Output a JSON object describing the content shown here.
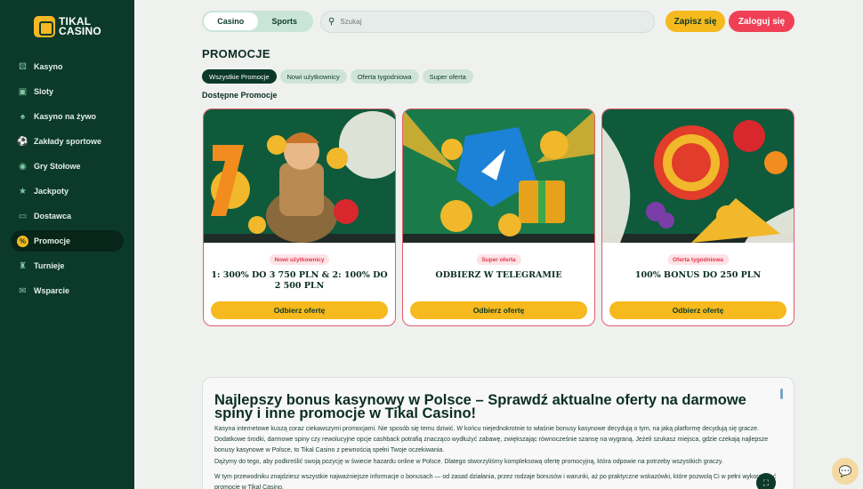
{
  "brand": {
    "line1": "TIKAL",
    "line2": "CASINO"
  },
  "sidebar": {
    "items": [
      {
        "label": "Kasyno",
        "icon": "dice-icon"
      },
      {
        "label": "Sloty",
        "icon": "slot-icon"
      },
      {
        "label": "Kasyno na żywo",
        "icon": "spade-icon"
      },
      {
        "label": "Zakłady sportowe",
        "icon": "football-icon"
      },
      {
        "label": "Gry Stołowe",
        "icon": "chips-icon"
      },
      {
        "label": "Jackpoty",
        "icon": "star-icon"
      },
      {
        "label": "Dostawca",
        "icon": "gamepad-icon"
      },
      {
        "label": "Promocje",
        "icon": "percent-icon",
        "active": true
      },
      {
        "label": "Turnieje",
        "icon": "trophy-icon"
      },
      {
        "label": "Wsparcie",
        "icon": "chat-icon"
      }
    ]
  },
  "header": {
    "tabs": [
      "Casino",
      "Sports"
    ],
    "search_placeholder": "Szukaj",
    "register_label": "Zapisz się",
    "login_label": "Zaloguj się"
  },
  "main": {
    "title": "PROMOCJE",
    "filters": [
      "Wszystkie Promocje",
      "Nowi użytkownicy",
      "Oferta tygodniowa",
      "Super oferta"
    ],
    "section_label": "Dostępne Promocje",
    "cards": [
      {
        "badge": "Nowi użytkownicy",
        "title": "1: 300% DO 3 750 PLN & 2: 100% DO 2 500 PLN",
        "button": "Odbierz ofertę"
      },
      {
        "badge": "Super oferta",
        "title": "ODBIERZ W TELEGRAMIE",
        "button": "Odbierz ofertę"
      },
      {
        "badge": "Oferta tygodniowa",
        "title": "100% BONUS DO 250 PLN",
        "button": "Odbierz ofertę"
      }
    ]
  },
  "article": {
    "heading": "Najlepszy bonus kasynowy w Polsce – Sprawdź aktualne oferty na darmowe spiny i inne promocje w Tikal Casino!",
    "p1": "Kasyna internetowe kuszą coraz ciekawszymi promocjami. Nie sposób się temu dziwić. W końcu niejednokrotnie to właśnie bonusy kasynowe decydują o tym, na jaką platformę decydują się gracze. Dodatkowe środki, darmowe spiny czy rewolucyjne opcje cashback potrafią znacząco wydłużyć zabawę, zwiększając równocześnie szansę na wygraną. Jeżeli szukasz miejsca, gdzie czekają najlepsze bonusy kasynowe w Polsce, to Tikal Casino z pewnością spełni Twoje oczekiwania.",
    "p2": "Dążymy do tego, aby podkreślić swoją pozycję w świecie hazardu online w Polsce. Dlatego stworzyliśmy kompleksową ofertę promocyjną, która odpowie na potrzeby wszystkich graczy.",
    "p3": "W tym przewodniku znajdziesz wszystkie najważniejsze informacje o bonusach — od zasad działania, przez rodzaje bonusów i warunki, aż po praktyczne wskazówki, które pozwolą Ci w pełni wykorzystać promocje w Tikal Casino."
  },
  "colors": {
    "sidebar": "#0c3a2a",
    "accent": "#f6b91e",
    "login": "#ef4056"
  }
}
